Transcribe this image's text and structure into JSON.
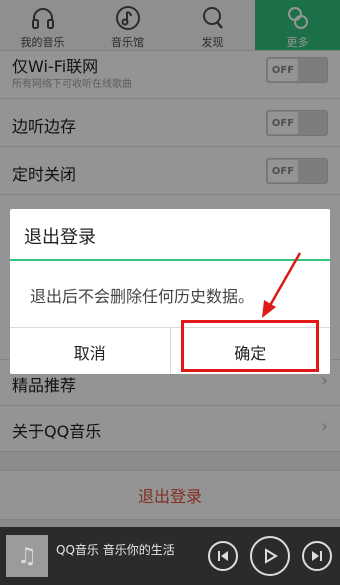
{
  "nav": {
    "tabs": [
      {
        "label": "我的音乐",
        "icon": "headphones-icon"
      },
      {
        "label": "音乐馆",
        "icon": "music-note-icon"
      },
      {
        "label": "发现",
        "icon": "search-icon"
      },
      {
        "label": "更多",
        "icon": "more-icon",
        "active": true
      }
    ]
  },
  "settings": {
    "wifi_only": {
      "title": "仅Wi-Fi联网",
      "subtitle": "所有网络下可收听在线歌曲",
      "toggle": "OFF"
    },
    "stream_cache": {
      "title": "边听边存",
      "toggle": "OFF"
    },
    "sleep_timer": {
      "title": "定时关闭",
      "toggle": "OFF"
    },
    "recommend": {
      "title": "精品推荐"
    },
    "about": {
      "title": "关于QQ音乐"
    },
    "logout": {
      "label": "退出登录"
    }
  },
  "dialog": {
    "title": "退出登录",
    "message": "退出后不会删除任何历史数据。",
    "cancel": "取消",
    "confirm": "确定"
  },
  "player": {
    "now_playing": "QQ音乐 音乐你的生活",
    "cover_icon": "music-note-icon"
  },
  "colors": {
    "accent": "#31c27c",
    "annotation": "#e01818",
    "logout": "#e0533a"
  }
}
